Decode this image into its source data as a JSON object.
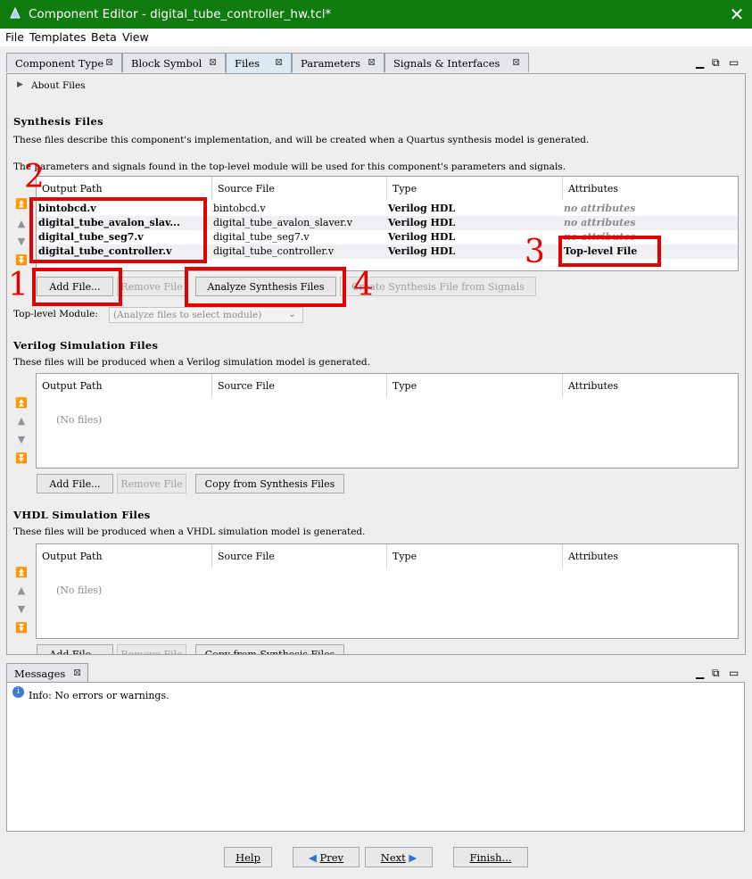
{
  "window": {
    "title": "Component Editor - digital_tube_controller_hw.tcl*",
    "close_glyph": "✕"
  },
  "menu": [
    "File",
    "Templates",
    "Beta",
    "View"
  ],
  "tabs": [
    {
      "label": "Component Type"
    },
    {
      "label": "Block Symbol"
    },
    {
      "label": "Files",
      "active": true
    },
    {
      "label": "Parameters"
    },
    {
      "label": "Signals & Interfaces"
    }
  ],
  "about": "About Files",
  "synthesis": {
    "title": "Synthesis Files",
    "desc1": "These files describe this component's implementation, and will be created when a Quartus synthesis model is generated.",
    "desc2": "The parameters and signals found in the top-level module will be used for this component's parameters and signals.",
    "columns": [
      "Output Path",
      "Source File",
      "Type",
      "Attributes"
    ],
    "rows": [
      {
        "output": "bintobcd.v",
        "source": "bintobcd.v",
        "type": "Verilog HDL",
        "attr": "no attributes"
      },
      {
        "output": "digital_tube_avalon_slav...",
        "source": "digital_tube_avalon_slaver.v",
        "type": "Verilog HDL",
        "attr": "no attributes"
      },
      {
        "output": "digital_tube_seg7.v",
        "source": "digital_tube_seg7.v",
        "type": "Verilog HDL",
        "attr": "no attributes"
      },
      {
        "output": "digital_tube_controller.v",
        "source": "digital_tube_controller.v",
        "type": "Verilog HDL",
        "attr": "Top-level File"
      }
    ],
    "buttons": {
      "add": "Add File...",
      "remove": "Remove File",
      "analyze": "Analyze Synthesis Files",
      "create": "Create Synthesis File from Signals"
    },
    "toplevel_label": "Top-level Module:",
    "toplevel_placeholder": "(Analyze files to select module)"
  },
  "verilog_sim": {
    "title": "Verilog Simulation Files",
    "desc": "These files will be produced when a Verilog simulation model is generated.",
    "columns": [
      "Output Path",
      "Source File",
      "Type",
      "Attributes"
    ],
    "empty": "(No files)",
    "buttons": {
      "add": "Add File...",
      "remove": "Remove File",
      "copy": "Copy from Synthesis Files"
    }
  },
  "vhdl_sim": {
    "title": "VHDL Simulation Files",
    "desc": "These files will be produced when a VHDL simulation model is generated.",
    "columns": [
      "Output Path",
      "Source File",
      "Type",
      "Attributes"
    ],
    "empty": "(No files)",
    "buttons": {
      "add": "Add File...",
      "remove": "Remove File",
      "copy": "Copy from Synthesis Files"
    }
  },
  "messages": {
    "tab": "Messages",
    "info": "Info: No errors or warnings."
  },
  "nav": {
    "help": "Help",
    "prev": "Prev",
    "next": "Next",
    "finish": "Finish..."
  },
  "annotations": [
    "1",
    "2",
    "3",
    "4"
  ],
  "colors": {
    "titlebar": "#107c10",
    "annotation": "#e30000",
    "panel": "#eeeeee"
  }
}
